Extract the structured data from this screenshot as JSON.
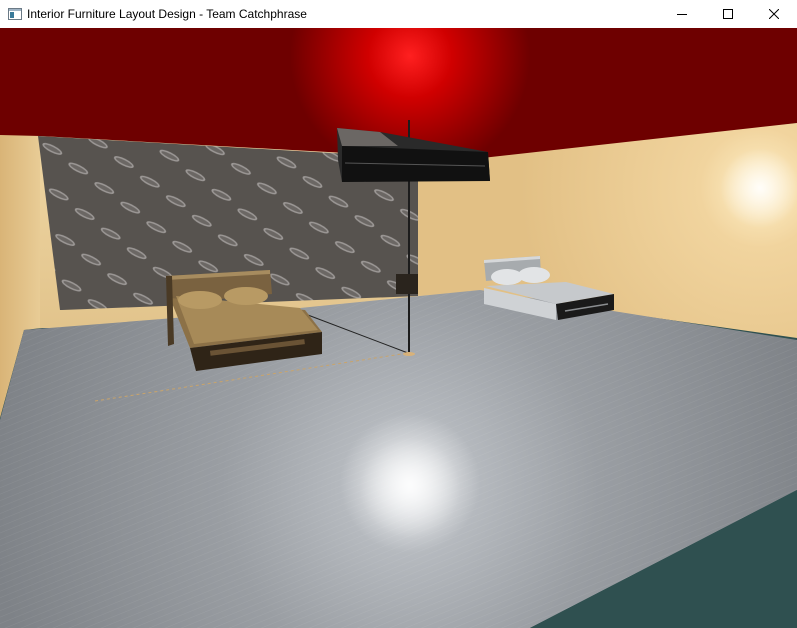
{
  "window": {
    "title": "Interior Furniture Layout Design - Team Catchphrase",
    "icon": "app-window-icon",
    "controls": {
      "minimize": "minimize-icon",
      "maximize": "maximize-icon",
      "close": "close-icon"
    }
  },
  "scene": {
    "background_color": "#2f5050",
    "ceiling_color": "#7a0000",
    "ceiling_light_color": "#ff1a1a",
    "wall_color": "#e6c58a",
    "floor_color": "#8f9398",
    "feature_wall_color": "#5e5a56"
  }
}
